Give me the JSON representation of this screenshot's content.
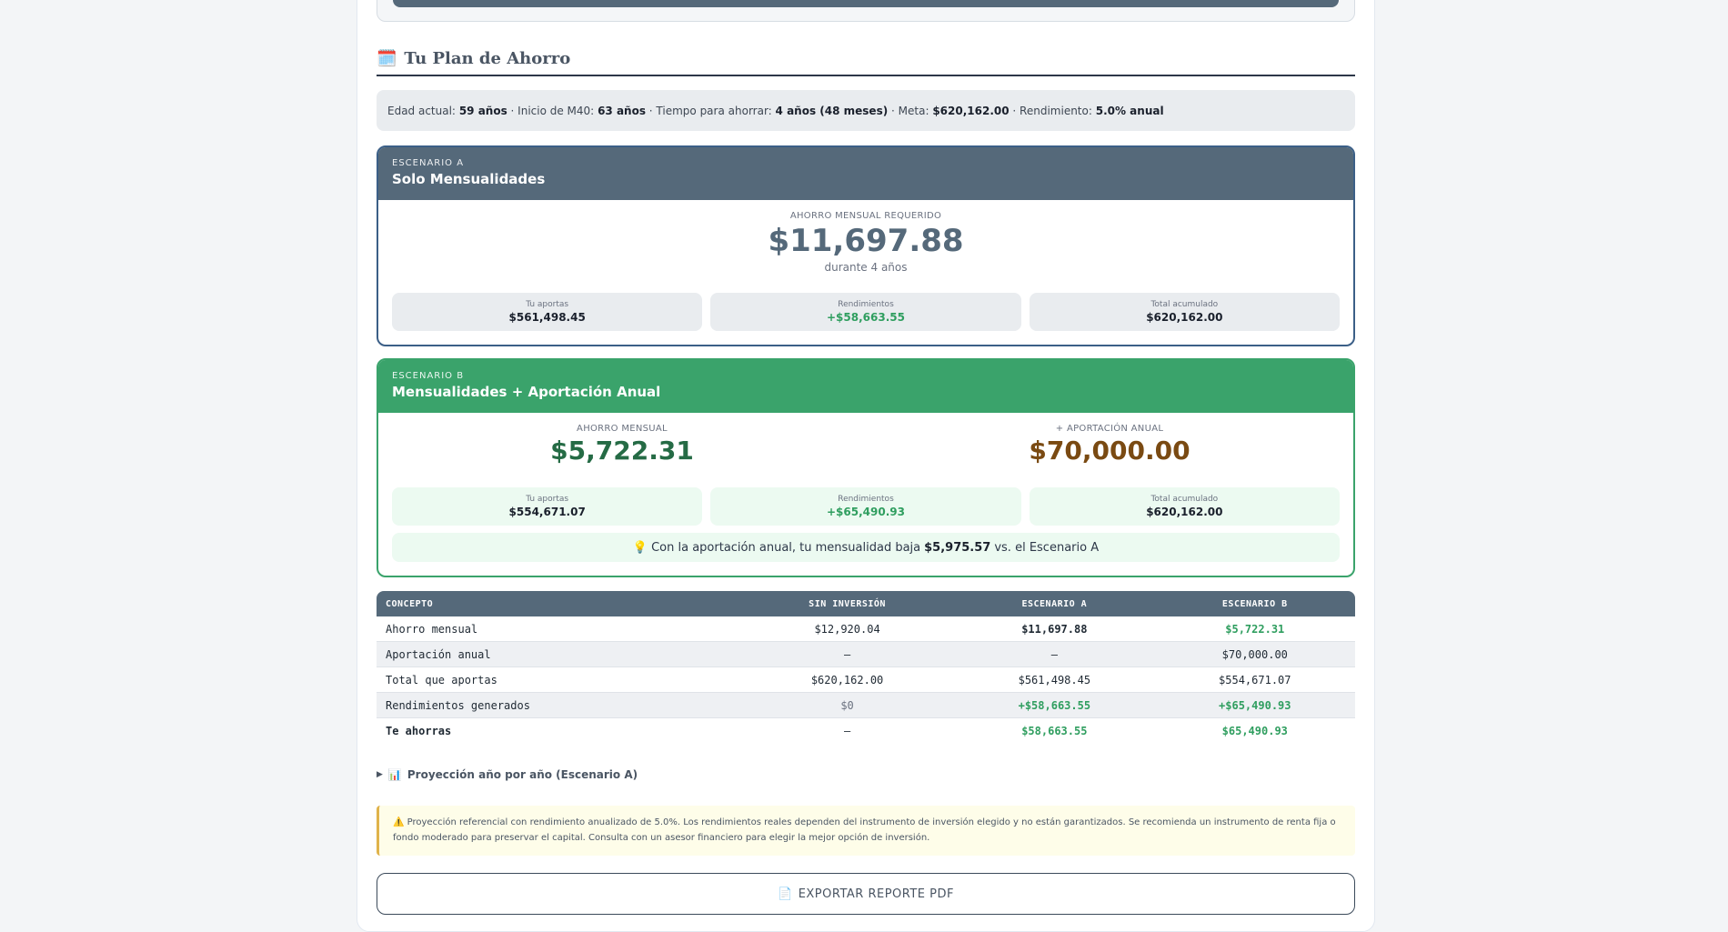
{
  "section": {
    "icon": "calendar-icon",
    "title": "Tu Plan de Ahorro"
  },
  "summary": {
    "edad_label": "Edad actual:",
    "edad": "59 años",
    "inicio_label": "· Inicio de M40:",
    "inicio": "63 años",
    "tiempo_label": "· Tiempo para ahorrar:",
    "tiempo": "4 años (48 meses)",
    "meta_label": "· Meta:",
    "meta": "$620,162.00",
    "rend_label": "· Rendimiento:",
    "rend": "5.0% anual"
  },
  "scenario_a": {
    "tag": "ESCENARIO A",
    "name": "Solo Mensualidades",
    "main_label": "AHORRO MENSUAL REQUERIDO",
    "main_value": "$11,697.88",
    "duration": "durante 4 años",
    "stats": [
      {
        "label": "Tu aportas",
        "value": "$561,498.45"
      },
      {
        "label": "Rendimientos",
        "value": "+$58,663.55"
      },
      {
        "label": "Total acumulado",
        "value": "$620,162.00"
      }
    ]
  },
  "scenario_b": {
    "tag": "ESCENARIO B",
    "name": "Mensualidades + Aportación Anual",
    "monthly_label": "AHORRO MENSUAL",
    "monthly_value": "$5,722.31",
    "annual_label": "+ APORTACIÓN ANUAL",
    "annual_value": "$70,000.00",
    "stats": [
      {
        "label": "Tu aportas",
        "value": "$554,671.07"
      },
      {
        "label": "Rendimientos",
        "value": "+$65,490.93"
      },
      {
        "label": "Total acumulado",
        "value": "$620,162.00"
      }
    ],
    "tip_icon": "lightbulb-icon",
    "tip_pre": "Con la aportación anual, tu mensualidad baja",
    "tip_amount": "$5,975.57",
    "tip_post": "vs. el Escenario A"
  },
  "table": {
    "headers": [
      "CONCEPTO",
      "SIN INVERSIÓN",
      "ESCENARIO A",
      "ESCENARIO B"
    ],
    "rows": [
      [
        "Ahorro mensual",
        "$12,920.04",
        "$11,697.88",
        "$5,722.31"
      ],
      [
        "Aportación anual",
        "—",
        "—",
        "$70,000.00"
      ],
      [
        "Total que aportas",
        "$620,162.00",
        "$561,498.45",
        "$554,671.07"
      ],
      [
        "Rendimientos generados",
        "$0",
        "+$58,663.55",
        "+$65,490.93"
      ],
      [
        "Te ahorras",
        "—",
        "$58,663.55",
        "$65,490.93"
      ]
    ]
  },
  "projection": {
    "toggle": "▶",
    "icon": "bar-chart-icon",
    "label": "Proyección año por año (Escenario A)"
  },
  "warning": {
    "icon": "warning-icon",
    "text": "Proyección referencial con rendimiento anualizado de 5.0%. Los rendimientos reales dependen del instrumento de inversión elegido y no están garantizados. Se recomienda un instrumento de renta fija o fondo moderado para preservar el capital. Consulta con un asesor financiero para elegir la mejor opción de inversión."
  },
  "export": {
    "icon": "document-icon",
    "label": "EXPORTAR REPORTE PDF"
  },
  "colors": {
    "slate": "#55697a",
    "green": "#3aa36b",
    "brown": "#7a4a12",
    "dark_green": "#256b45"
  }
}
